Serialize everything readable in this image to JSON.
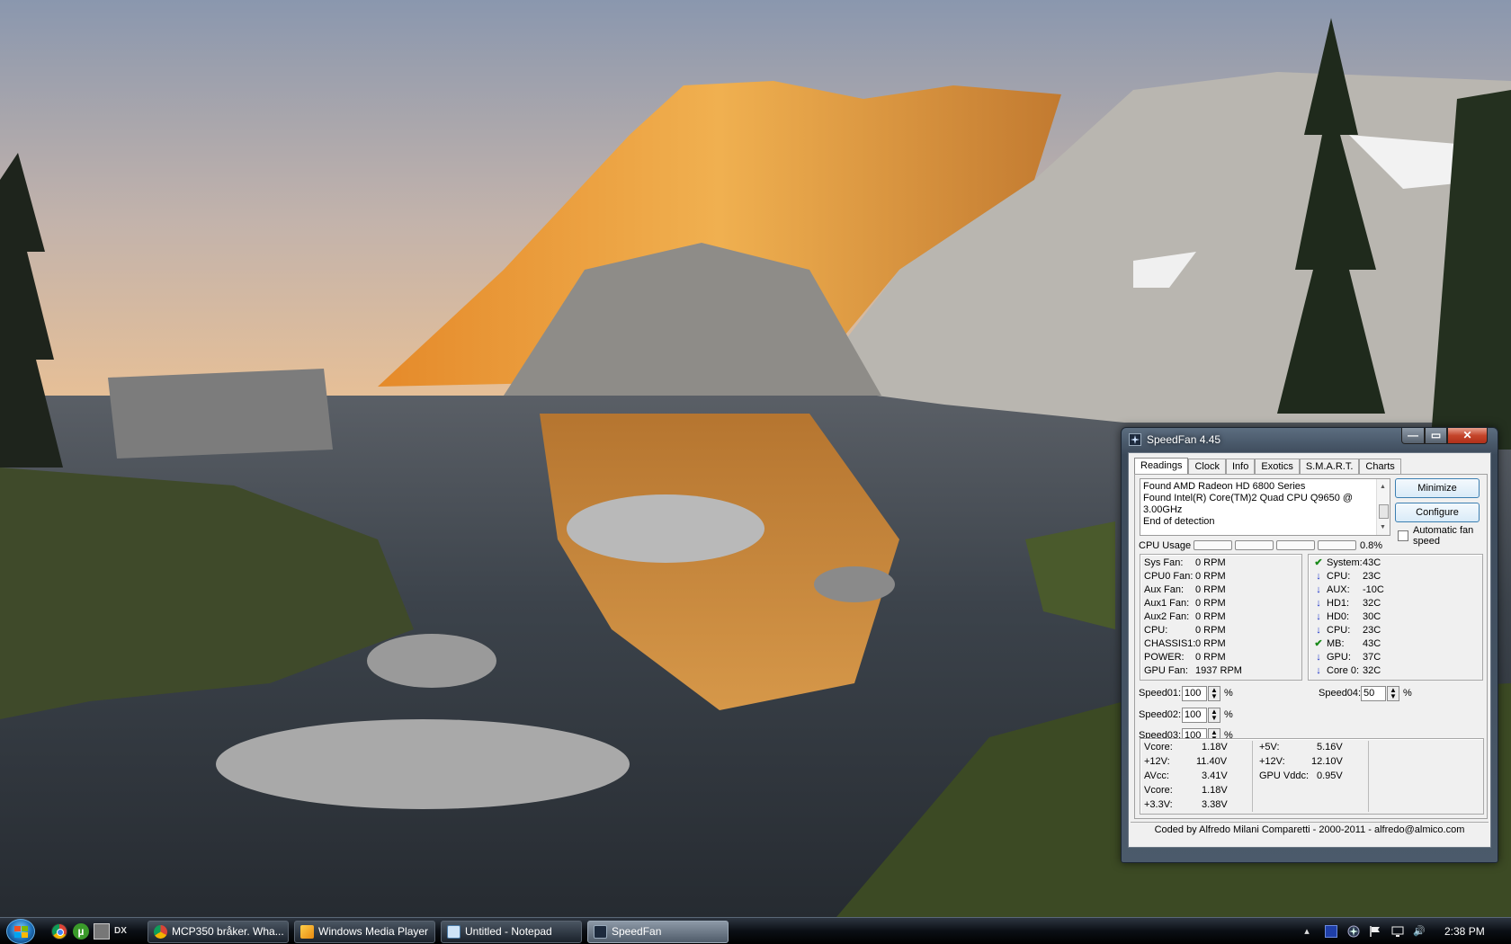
{
  "window": {
    "title": "SpeedFan 4.45",
    "controls": {
      "minimize": "—",
      "maximize": "▭",
      "close": "✕"
    }
  },
  "tabs": [
    "Readings",
    "Clock",
    "Info",
    "Exotics",
    "S.M.A.R.T.",
    "Charts"
  ],
  "log": [
    "Found AMD Radeon HD 6800 Series",
    "Found Intel(R) Core(TM)2 Quad CPU Q9650 @ 3.00GHz",
    "End of detection"
  ],
  "buttons": {
    "minimize": "Minimize",
    "configure": "Configure"
  },
  "auto_fan": {
    "label": "Automatic fan speed",
    "checked": false
  },
  "cpu_usage": {
    "label": "CPU Usage",
    "value": "0.8%",
    "fraction": 0.008
  },
  "fans": [
    {
      "name": "Sys Fan:",
      "value": "0 RPM"
    },
    {
      "name": "CPU0 Fan:",
      "value": "0 RPM"
    },
    {
      "name": "Aux Fan:",
      "value": "0 RPM"
    },
    {
      "name": "Aux1 Fan:",
      "value": "0 RPM"
    },
    {
      "name": "Aux2 Fan:",
      "value": "0 RPM"
    },
    {
      "name": "CPU:",
      "value": "0 RPM"
    },
    {
      "name": "CHASSIS1:",
      "value": "0 RPM"
    },
    {
      "name": "POWER:",
      "value": "0 RPM"
    },
    {
      "name": "GPU Fan:",
      "value": "1937 RPM"
    }
  ],
  "temps": [
    {
      "name": "System:",
      "value": "43C",
      "status": "ok"
    },
    {
      "name": "CPU:",
      "value": "23C",
      "status": "down"
    },
    {
      "name": "AUX:",
      "value": "-10C",
      "status": "down"
    },
    {
      "name": "HD1:",
      "value": "32C",
      "status": "down"
    },
    {
      "name": "HD0:",
      "value": "30C",
      "status": "down"
    },
    {
      "name": "CPU:",
      "value": "23C",
      "status": "down"
    },
    {
      "name": "MB:",
      "value": "43C",
      "status": "ok"
    },
    {
      "name": "GPU:",
      "value": "37C",
      "status": "down"
    },
    {
      "name": "Core 0:",
      "value": "32C",
      "status": "down"
    }
  ],
  "temp_icons": {
    "ok": "✔",
    "down": "↓",
    "ok_color": "#1a8a1a",
    "down_color": "#1830c8"
  },
  "speeds": [
    {
      "label": "Speed01:",
      "value": "100",
      "unit": "%"
    },
    {
      "label": "Speed02:",
      "value": "100",
      "unit": "%"
    },
    {
      "label": "Speed03:",
      "value": "100",
      "unit": "%"
    },
    {
      "label": "Speed04:",
      "value": "50",
      "unit": "%"
    }
  ],
  "voltages_col1": [
    {
      "name": "Vcore:",
      "value": "1.18V"
    },
    {
      "name": "+12V:",
      "value": "11.40V"
    },
    {
      "name": "AVcc:",
      "value": "3.41V"
    },
    {
      "name": "Vcore:",
      "value": "1.18V"
    },
    {
      "name": "+3.3V:",
      "value": "3.38V"
    }
  ],
  "voltages_col2": [
    {
      "name": "+5V:",
      "value": "5.16V"
    },
    {
      "name": "+12V:",
      "value": "12.10V"
    },
    {
      "name": "GPU Vddc:",
      "value": "0.95V"
    }
  ],
  "status_bar": "Coded by Alfredo Milani Comparetti - 2000-2011 - alfredo@almico.com",
  "taskbar": {
    "quick_launch": {
      "utorrent": "µ",
      "dx": "DX"
    },
    "tasks": [
      {
        "label": "MCP350 bråker. Wha...",
        "icon": "chrome-icon"
      },
      {
        "label": "Windows Media Player",
        "icon": "media-player-icon"
      },
      {
        "label": "Untitled - Notepad",
        "icon": "notepad-icon"
      },
      {
        "label": "SpeedFan",
        "icon": "speedfan-icon",
        "active": true
      }
    ],
    "tray_icons": [
      "show-hidden-icon",
      "network-icon",
      "speedfan-tray-icon",
      "flag-icon",
      "monitor-icon",
      "volume-icon"
    ],
    "tray_glyphs": {
      "chevron": "▴",
      "speaker": "🔊"
    },
    "clock": "2:38 PM"
  }
}
